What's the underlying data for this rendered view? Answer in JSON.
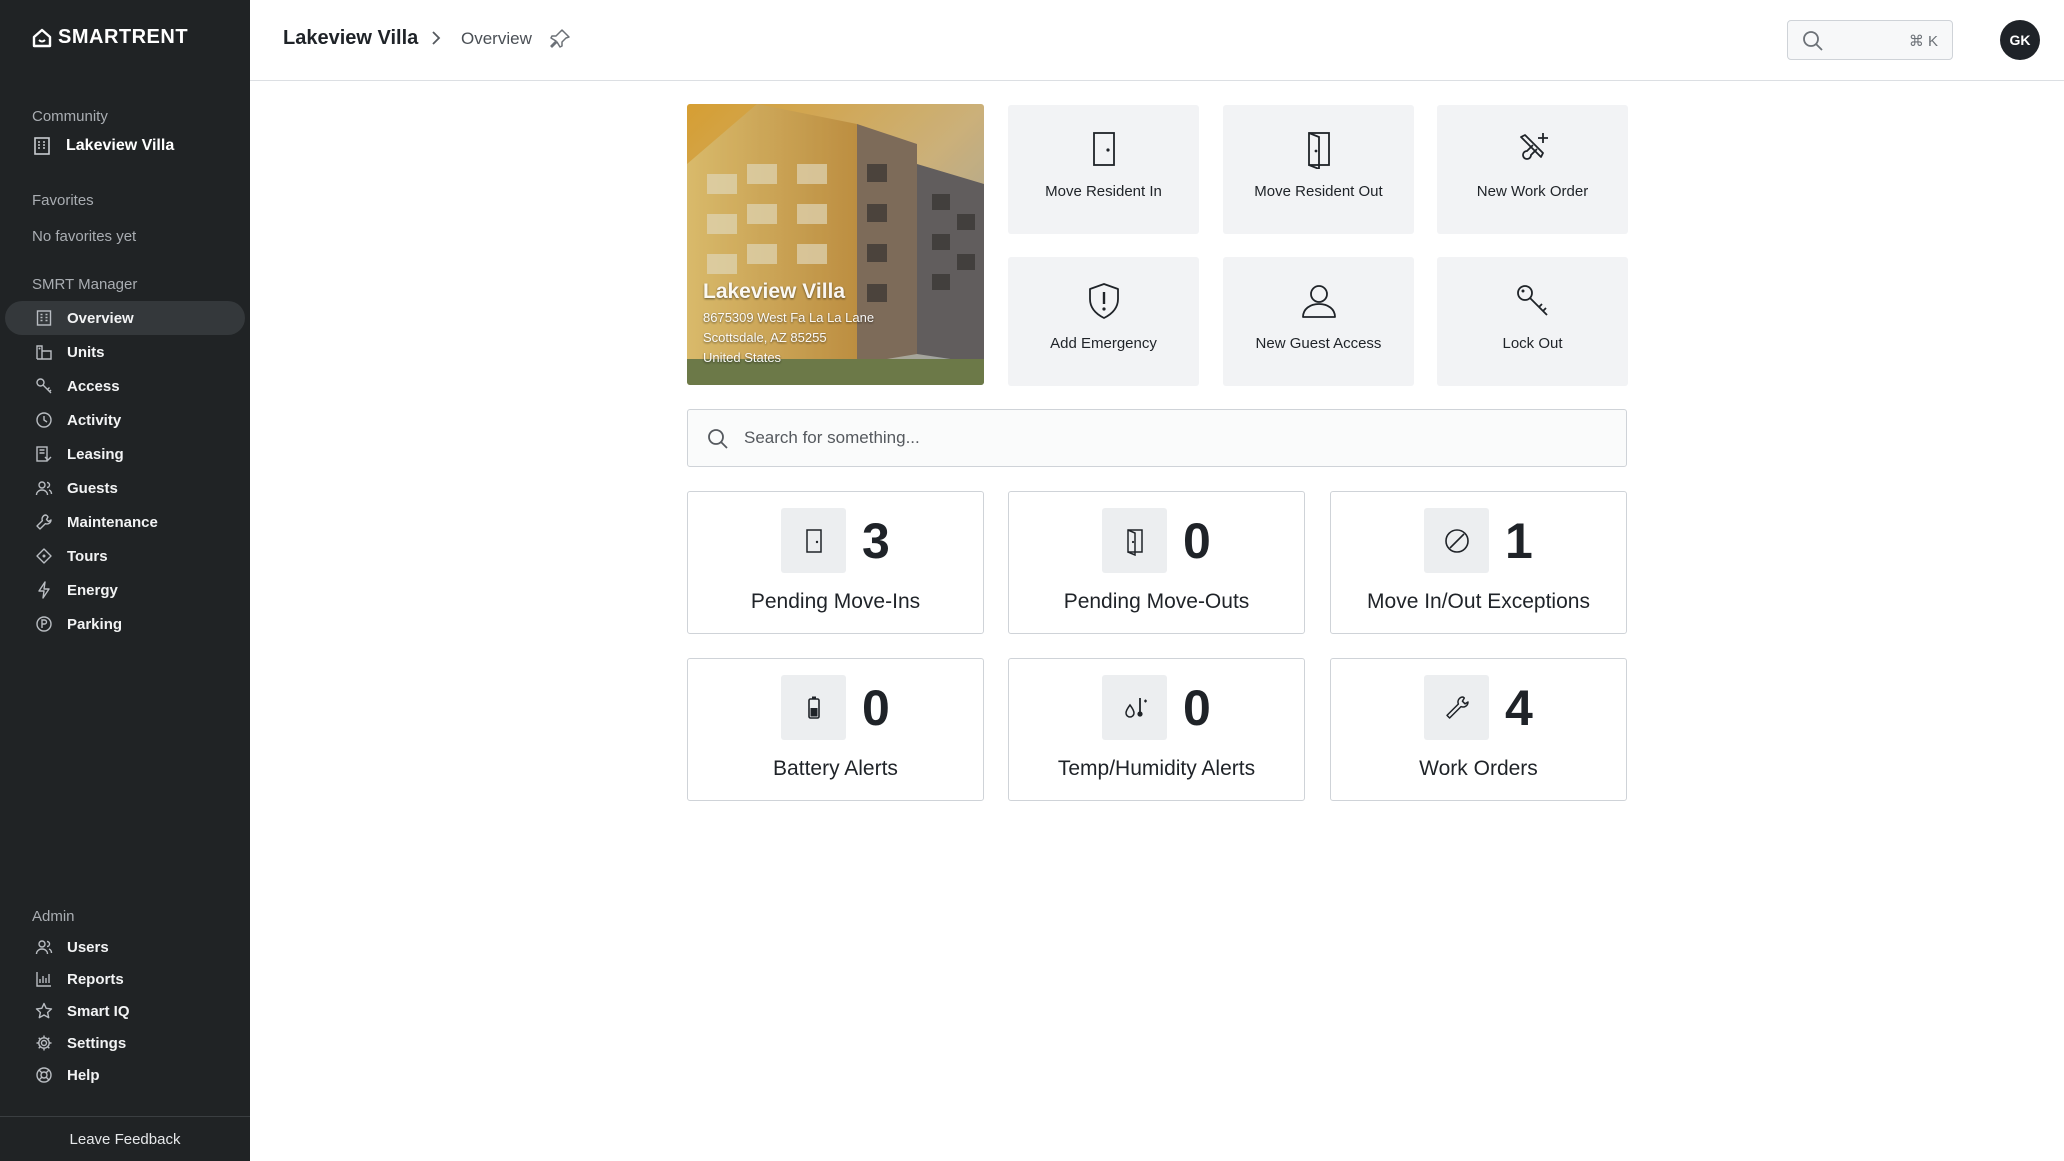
{
  "app": {
    "logo_text": "SmartRent"
  },
  "sidebar": {
    "community_label": "Community",
    "community_name": "Lakeview Villa",
    "favorites_label": "Favorites",
    "favorites_empty": "No favorites yet",
    "manager_label": "SMRT Manager",
    "manager_items": [
      {
        "label": "Overview",
        "icon": "building-icon",
        "active": true
      },
      {
        "label": "Units",
        "icon": "units-icon"
      },
      {
        "label": "Access",
        "icon": "key-icon"
      },
      {
        "label": "Activity",
        "icon": "clock-icon"
      },
      {
        "label": "Leasing",
        "icon": "leasing-icon"
      },
      {
        "label": "Guests",
        "icon": "guests-icon"
      },
      {
        "label": "Maintenance",
        "icon": "wrench-icon"
      },
      {
        "label": "Tours",
        "icon": "tag-icon"
      },
      {
        "label": "Energy",
        "icon": "bolt-icon"
      },
      {
        "label": "Parking",
        "icon": "parking-icon"
      }
    ],
    "admin_label": "Admin",
    "admin_items": [
      {
        "label": "Users",
        "icon": "users-icon"
      },
      {
        "label": "Reports",
        "icon": "chart-icon"
      },
      {
        "label": "Smart IQ",
        "icon": "star-icon"
      },
      {
        "label": "Settings",
        "icon": "gear-icon"
      },
      {
        "label": "Help",
        "icon": "help-icon"
      }
    ],
    "feedback_label": "Leave Feedback"
  },
  "header": {
    "breadcrumb_root": "Lakeview Villa",
    "breadcrumb_current": "Overview",
    "search_shortcut": "⌘ K",
    "avatar_initials": "GK"
  },
  "property": {
    "name": "Lakeview Villa",
    "address_line1": "8675309 West Fa La La Lane",
    "address_line2": "Scottsdale, AZ 85255",
    "address_line3": "United States"
  },
  "quick_actions": [
    {
      "label": "Move Resident In",
      "icon": "door-closed-icon"
    },
    {
      "label": "Move Resident Out",
      "icon": "door-open-icon"
    },
    {
      "label": "New Work Order",
      "icon": "tools-plus-icon"
    },
    {
      "label": "Add Emergency",
      "icon": "shield-alert-icon"
    },
    {
      "label": "New Guest Access",
      "icon": "person-icon"
    },
    {
      "label": "Lock Out",
      "icon": "key-wrench-icon"
    }
  ],
  "search": {
    "placeholder": "Search for something..."
  },
  "stats": [
    {
      "value": "3",
      "label": "Pending Move-Ins",
      "icon": "door-closed-icon"
    },
    {
      "value": "0",
      "label": "Pending Move-Outs",
      "icon": "door-open-icon"
    },
    {
      "value": "1",
      "label": "Move In/Out Exceptions",
      "icon": "ban-icon"
    },
    {
      "value": "0",
      "label": "Battery Alerts",
      "icon": "battery-icon"
    },
    {
      "value": "0",
      "label": "Temp/Humidity Alerts",
      "icon": "thermometer-icon"
    },
    {
      "value": "4",
      "label": "Work Orders",
      "icon": "wrench-icon"
    }
  ],
  "colors": {
    "sidebar_bg": "#202325",
    "sidebar_active": "#34383b",
    "tile_bg": "#f2f3f5"
  }
}
